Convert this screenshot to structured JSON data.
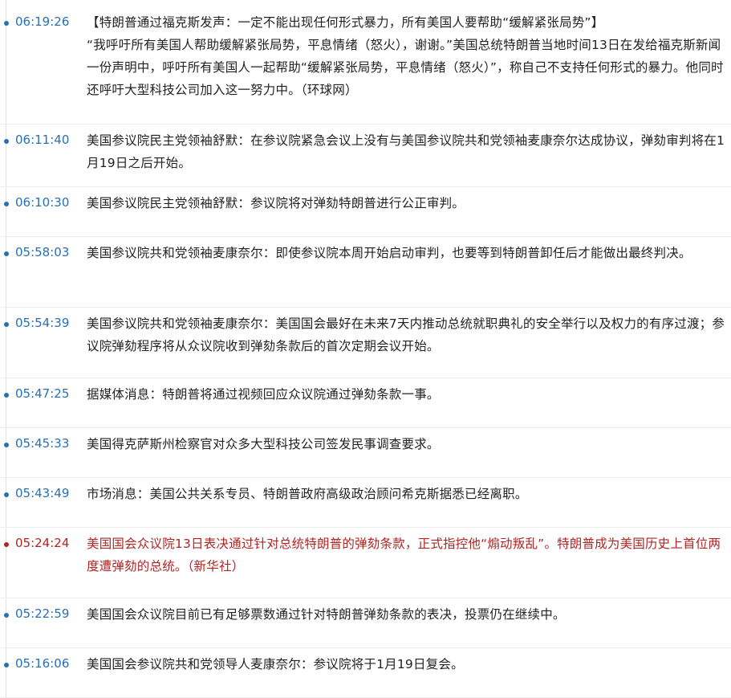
{
  "colors": {
    "time": "#2a6fb0",
    "highlight": "#b22424",
    "text": "#222222",
    "divider": "#ececec"
  },
  "items": [
    {
      "time": "06:19:26",
      "title": "【特朗普通过福克斯发声：一定不能出现任何形式暴力，所有美国人要帮助“缓解紧张局势”】",
      "text": "“我呼吁所有美国人帮助缓解紧张局势，平息情绪（怒火），谢谢。”美国总统特朗普当地时间13日在发给福克斯新闻一份声明中，呼吁所有美国人一起帮助“缓解紧张局势，平息情绪（怒火）”，称自己不支持任何形式的暴力。他同时还呼吁大型科技公司加入这一努力中。（环球网）",
      "highlight": false
    },
    {
      "time": "06:11:40",
      "title": "",
      "text": "美国参议院民主党领袖舒默：在参议院紧急会议上没有与美国参议院共和党领袖麦康奈尔达成协议，弹劾审判将在1月19日之后开始。",
      "highlight": false
    },
    {
      "time": "06:10:30",
      "title": "",
      "text": "美国参议院民主党领袖舒默：参议院将对弹劾特朗普进行公正审判。",
      "highlight": false
    },
    {
      "time": "05:58:03",
      "title": "",
      "text": "美国参议院共和党领袖麦康奈尔：即使参议院本周开始启动审判，也要等到特朗普卸任后才能做出最终判决。",
      "highlight": false
    },
    {
      "time": "05:54:39",
      "title": "",
      "text": "美国参议院共和党领袖麦康奈尔：美国国会最好在未来7天内推动总统就职典礼的安全举行以及权力的有序过渡；参议院弹劾程序将从众议院收到弹劾条款后的首次定期会议开始。",
      "highlight": false
    },
    {
      "time": "05:47:25",
      "title": "",
      "text": "据媒体消息：特朗普将通过视频回应众议院通过弹劾条款一事。",
      "highlight": false
    },
    {
      "time": "05:45:33",
      "title": "",
      "text": "美国得克萨斯州检察官对众多大型科技公司签发民事调查要求。",
      "highlight": false
    },
    {
      "time": "05:43:49",
      "title": "",
      "text": "市场消息：美国公共关系专员、特朗普政府高级政治顾问希克斯据悉已经离职。",
      "highlight": false
    },
    {
      "time": "05:24:24",
      "title": "",
      "text": "美国国会众议院13日表决通过针对总统特朗普的弹劾条款，正式指控他“煽动叛乱”。特朗普成为美国历史上首位两度遭弹劾的总统。（新华社）",
      "highlight": true
    },
    {
      "time": "05:22:59",
      "title": "",
      "text": "美国国会众议院目前已有足够票数通过针对特朗普弹劾条款的表决，投票仍在继续中。",
      "highlight": false
    },
    {
      "time": "05:16:06",
      "title": "",
      "text": "美国国会参议院共和党领导人麦康奈尔：参议院将于1月19日复会。",
      "highlight": false
    }
  ]
}
